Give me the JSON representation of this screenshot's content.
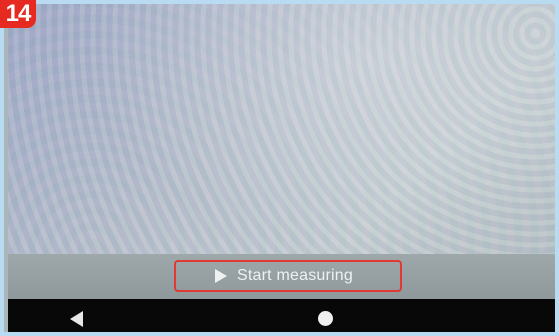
{
  "step_badge": {
    "number": "14"
  },
  "action": {
    "start_label": "Start measuring"
  },
  "icons": {
    "play": "play-icon",
    "back": "back-triangle-icon",
    "home": "home-circle-icon",
    "recents": "recents-square-icon"
  },
  "colors": {
    "badge": "#e62a22",
    "highlight_border": "#e03a33",
    "navigation_bar": "#080808"
  }
}
